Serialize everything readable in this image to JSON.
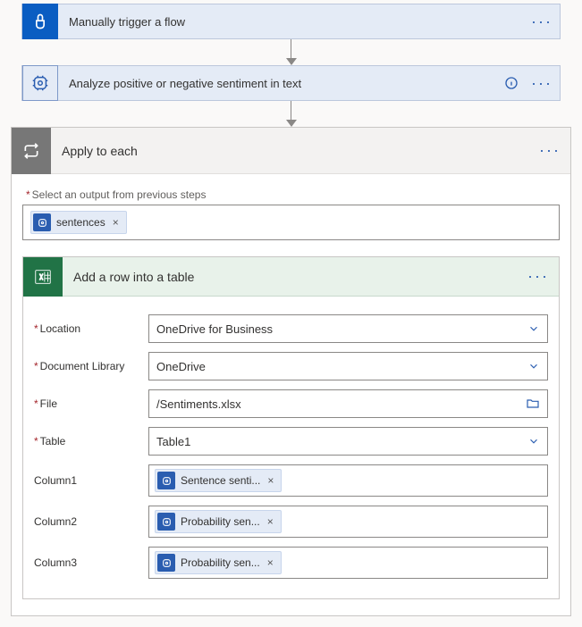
{
  "step1": {
    "title": "Manually trigger a flow"
  },
  "step2": {
    "title": "Analyze positive or negative sentiment in text"
  },
  "foreach": {
    "title": "Apply to each",
    "selectLabel": "Select an output from previous steps",
    "token": "sentences"
  },
  "excel": {
    "title": "Add a row into a table",
    "fields": {
      "location": {
        "label": "Location",
        "value": "OneDrive for Business"
      },
      "library": {
        "label": "Document Library",
        "value": "OneDrive"
      },
      "file": {
        "label": "File",
        "value": "/Sentiments.xlsx"
      },
      "table": {
        "label": "Table",
        "value": "Table1"
      },
      "col1": {
        "label": "Column1",
        "token": "Sentence senti..."
      },
      "col2": {
        "label": "Column2",
        "token": "Probability sen..."
      },
      "col3": {
        "label": "Column3",
        "token": "Probability sen..."
      }
    }
  }
}
